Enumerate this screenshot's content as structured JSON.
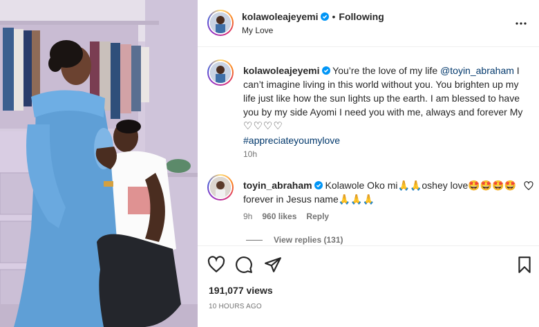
{
  "post": {
    "author": "kolawoleajeyemi",
    "following_label": "Following",
    "dot": "•",
    "subtitle": "My Love"
  },
  "caption": {
    "author": "kolawoleajeyemi",
    "text_before": " You’re the love of my life ",
    "mention": "@toyin_abraham",
    "text_after": " I can’t imagine living in this world without you. You brighten up my life just like how the sun lights up the earth. I am blessed to have you by my side Ayomi I need you with me, always and forever My ",
    "hearts": "♡♡♡♡",
    "hashtag": "#appreciateyoumylove",
    "time": "10h"
  },
  "comment": {
    "author": "toyin_abraham",
    "text": " Kolawole Oko mi🙏🙏oshey love🤩🤩🤩🤩forever in Jesus name🙏🙏🙏",
    "time": "9h",
    "likes": "960 likes",
    "reply_label": "Reply",
    "view_replies": "View replies (131)"
  },
  "footer": {
    "views": "191,077 views",
    "ago": "10 HOURS AGO"
  },
  "icons": [
    "verified-icon",
    "more-options-icon",
    "like-heart-icon",
    "comment-icon",
    "share-icon",
    "save-icon",
    "comment-like-icon"
  ],
  "colors": {
    "link": "#00376b",
    "verified": "#0095f6",
    "muted": "#737373",
    "text": "#262626"
  }
}
